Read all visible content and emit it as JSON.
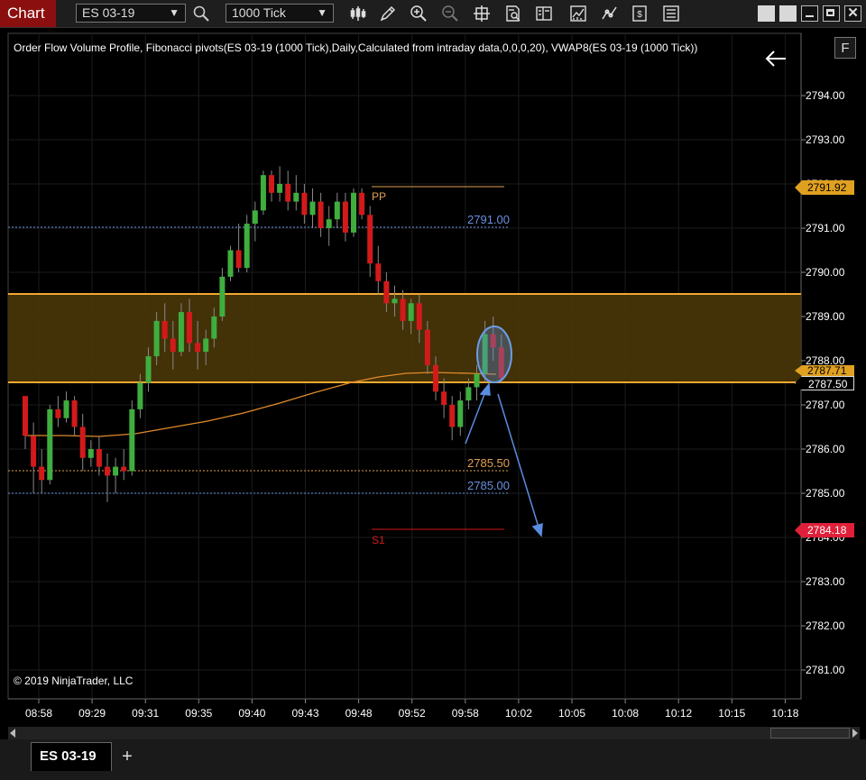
{
  "toolbar": {
    "chart_tab_label": "Chart",
    "instrument": "ES 03-19",
    "interval": "1000 Tick",
    "icons": [
      "bar-type-icon",
      "drawing-tool-icon",
      "zoom-in-icon",
      "zoom-out-icon",
      "crosshair-icon",
      "data-box-icon",
      "properties-icon",
      "indicators-icon",
      "strategies-icon",
      "chart-trader-icon",
      "templates-icon"
    ],
    "window_controls": [
      "restore-icon",
      "minimize-icon",
      "maximize-icon",
      "close-icon"
    ]
  },
  "chart": {
    "legend": "Order Flow Volume Profile, Fibonacci pivots(ES 03-19 (1000 Tick),Daily,Calculated from intraday data,0,0,0,20), VWAP8(ES 03-19 (1000 Tick))",
    "f_button": "F",
    "copyright": "© 2019 NinjaTrader, LLC",
    "colors": {
      "up": "#3fae3f",
      "down": "#d21a1a",
      "vwap": "#e08a2a",
      "zone": "#4a3608",
      "zone_border": "#f0a830",
      "pivot_blue": "#6a8fe0",
      "pp": "#e0a050",
      "s1": "#d21a1a",
      "arrow": "#5a8de0"
    },
    "y_axis": [
      "2794.00",
      "2793.00",
      "2792.00",
      "2791.00",
      "2790.00",
      "2789.00",
      "2788.00",
      "2787.00",
      "2786.00",
      "2785.00",
      "2784.00",
      "2783.00",
      "2782.00",
      "2781.00"
    ],
    "x_axis": [
      "08:58",
      "09:29",
      "09:31",
      "09:35",
      "09:40",
      "09:43",
      "09:48",
      "09:52",
      "09:58",
      "10:02",
      "10:05",
      "10:08",
      "10:12",
      "10:15",
      "10:18"
    ],
    "levels": {
      "pp_label": "PP",
      "r_level": "2791.00",
      "mid_level": "2785.50",
      "s_level": "2785.00",
      "s1_label": "S1"
    },
    "price_tags": {
      "high": "2791.92",
      "vwap": "2787.71",
      "zone_low": "2787.50",
      "target": "2784.18"
    }
  },
  "chart_data": {
    "type": "candlestick",
    "ylim": [
      2780.5,
      2795.0
    ],
    "candles": [
      [
        2787.2,
        2787.0,
        2786.0,
        2786.3
      ],
      [
        2786.3,
        2786.6,
        2785.0,
        2785.6
      ],
      [
        2785.6,
        2786.0,
        2785.0,
        2785.3
      ],
      [
        2785.3,
        2787.0,
        2785.2,
        2786.9
      ],
      [
        2786.9,
        2787.2,
        2786.5,
        2786.7
      ],
      [
        2786.7,
        2787.3,
        2786.6,
        2787.1
      ],
      [
        2787.1,
        2787.2,
        2786.3,
        2786.5
      ],
      [
        2786.5,
        2786.8,
        2785.5,
        2785.8
      ],
      [
        2785.8,
        2786.2,
        2785.6,
        2786.0
      ],
      [
        2786.0,
        2786.3,
        2785.4,
        2785.6
      ],
      [
        2785.6,
        2785.9,
        2784.8,
        2785.4
      ],
      [
        2785.4,
        2785.8,
        2785.0,
        2785.6
      ],
      [
        2785.6,
        2786.0,
        2785.3,
        2785.5
      ],
      [
        2785.5,
        2787.1,
        2785.4,
        2786.9
      ],
      [
        2786.9,
        2787.7,
        2786.7,
        2787.5
      ],
      [
        2787.5,
        2788.3,
        2787.3,
        2788.1
      ],
      [
        2788.1,
        2789.1,
        2787.9,
        2788.9
      ],
      [
        2788.9,
        2789.3,
        2788.2,
        2788.5
      ],
      [
        2788.5,
        2788.9,
        2787.8,
        2788.2
      ],
      [
        2788.2,
        2789.3,
        2788.1,
        2789.1
      ],
      [
        2789.1,
        2789.4,
        2788.2,
        2788.4
      ],
      [
        2788.4,
        2788.9,
        2787.8,
        2788.2
      ],
      [
        2788.2,
        2788.7,
        2787.9,
        2788.5
      ],
      [
        2788.5,
        2789.2,
        2788.3,
        2789.0
      ],
      [
        2789.0,
        2790.1,
        2788.9,
        2789.9
      ],
      [
        2789.9,
        2790.6,
        2789.8,
        2790.5
      ],
      [
        2790.5,
        2791.1,
        2790.0,
        2790.1
      ],
      [
        2790.1,
        2791.3,
        2790.0,
        2791.1
      ],
      [
        2791.1,
        2791.6,
        2790.7,
        2791.4
      ],
      [
        2791.4,
        2792.3,
        2791.3,
        2792.2
      ],
      [
        2792.2,
        2792.3,
        2791.6,
        2791.8
      ],
      [
        2791.8,
        2792.4,
        2791.6,
        2792.0
      ],
      [
        2792.0,
        2792.3,
        2791.4,
        2791.6
      ],
      [
        2791.6,
        2792.2,
        2791.4,
        2791.8
      ],
      [
        2791.8,
        2792.0,
        2791.1,
        2791.3
      ],
      [
        2791.3,
        2791.9,
        2791.0,
        2791.6
      ],
      [
        2791.6,
        2791.8,
        2790.8,
        2791.0
      ],
      [
        2791.0,
        2791.5,
        2790.6,
        2791.2
      ],
      [
        2791.2,
        2791.8,
        2791.0,
        2791.6
      ],
      [
        2791.6,
        2791.8,
        2790.7,
        2790.9
      ],
      [
        2790.9,
        2791.9,
        2790.8,
        2791.8
      ],
      [
        2791.8,
        2791.9,
        2791.2,
        2791.3
      ],
      [
        2791.3,
        2791.5,
        2789.9,
        2790.2
      ],
      [
        2790.2,
        2790.6,
        2789.5,
        2789.8
      ],
      [
        2789.8,
        2790.0,
        2789.1,
        2789.3
      ],
      [
        2789.3,
        2789.7,
        2789.0,
        2789.4
      ],
      [
        2789.4,
        2789.6,
        2788.7,
        2788.9
      ],
      [
        2788.9,
        2789.4,
        2788.6,
        2789.3
      ],
      [
        2789.3,
        2789.5,
        2788.4,
        2788.7
      ],
      [
        2788.7,
        2788.9,
        2787.7,
        2787.9
      ],
      [
        2787.9,
        2788.1,
        2787.1,
        2787.3
      ],
      [
        2787.3,
        2787.6,
        2786.7,
        2787.0
      ],
      [
        2787.0,
        2787.2,
        2786.2,
        2786.5
      ],
      [
        2786.5,
        2787.3,
        2786.3,
        2787.1
      ],
      [
        2787.1,
        2787.6,
        2786.9,
        2787.4
      ],
      [
        2787.4,
        2787.9,
        2787.1,
        2787.7
      ],
      [
        2787.7,
        2788.9,
        2787.5,
        2788.6
      ],
      [
        2788.6,
        2789.0,
        2788.0,
        2788.3
      ],
      [
        2788.3,
        2788.6,
        2787.5,
        2787.6
      ]
    ]
  }
}
